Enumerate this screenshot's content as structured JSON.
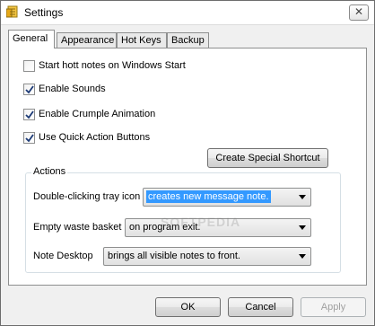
{
  "window": {
    "title": "Settings",
    "close_glyph": "✕",
    "app_icon": "notes-app-icon"
  },
  "tabs": [
    {
      "label": "General",
      "active": true
    },
    {
      "label": "Appearance",
      "active": false
    },
    {
      "label": "Hot Keys",
      "active": false
    },
    {
      "label": "Backup",
      "active": false
    }
  ],
  "general": {
    "checkboxes": [
      {
        "label": "Start hott notes on Windows Start",
        "checked": false
      },
      {
        "label": "Enable Sounds",
        "checked": true
      },
      {
        "label": "Enable Crumple Animation",
        "checked": true
      },
      {
        "label": "Use Quick Action Buttons",
        "checked": true
      }
    ],
    "shortcut_button": "Create Special Shortcut",
    "actions": {
      "title": "Actions",
      "rows": [
        {
          "label": "Double-clicking tray icon",
          "value": "creates new message note."
        },
        {
          "label": "Empty waste basket",
          "value": "on program exit."
        },
        {
          "label": "Note Desktop",
          "value": "brings all visible notes to front."
        }
      ]
    }
  },
  "watermark": "SOFTPEDIA",
  "footer": {
    "ok": "OK",
    "cancel": "Cancel",
    "apply": "Apply"
  }
}
